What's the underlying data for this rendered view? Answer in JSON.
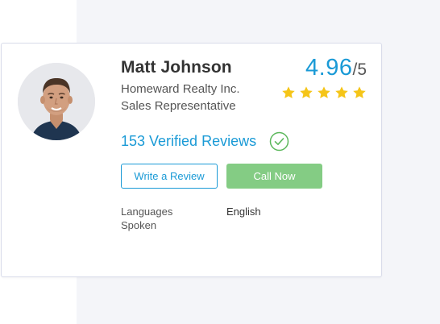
{
  "agent": {
    "name": "Matt Johnson",
    "company": "Homeward Realty Inc.",
    "title": "Sales Representative"
  },
  "rating": {
    "value": "4.96",
    "max": "/5",
    "stars": 5,
    "star_color": "#f5c518"
  },
  "reviews": {
    "label": "153 Verified Reviews",
    "verified_icon": "check-circle-icon"
  },
  "actions": {
    "write_review_label": "Write a Review",
    "call_now_label": "Call Now"
  },
  "languages": {
    "label": "Languages Spoken",
    "value": "English"
  },
  "colors": {
    "accent": "#1a9ad6",
    "call_button": "#84cc84",
    "verified_green": "#5cb85c",
    "page_panel": "#f4f5f9"
  }
}
